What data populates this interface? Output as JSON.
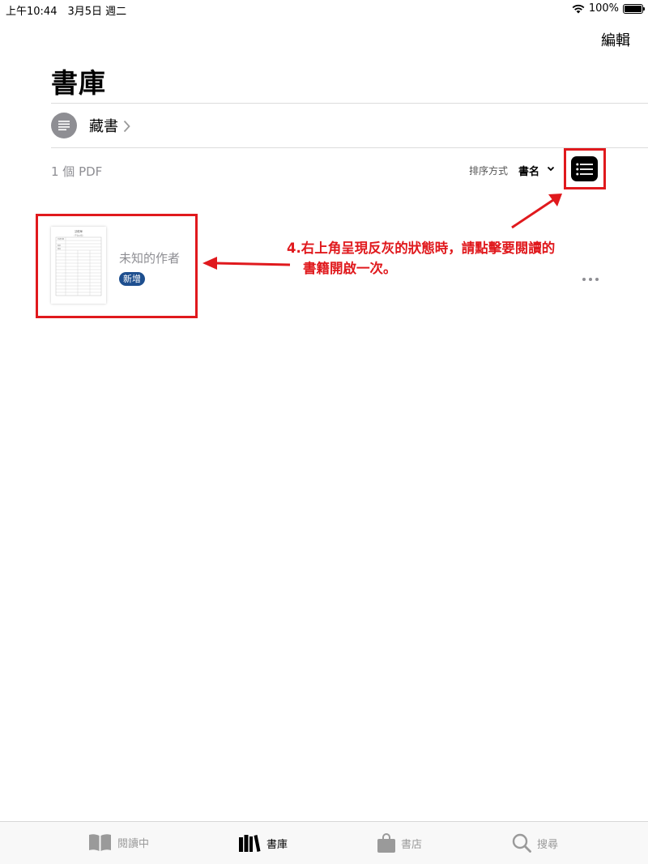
{
  "status_bar": {
    "time_date": "上午10:44　3月5日 週二",
    "battery": "100%",
    "battery_level": 1.0
  },
  "nav": {
    "edit_label": "編輯",
    "title": "書庫"
  },
  "collection": {
    "label": "藏書"
  },
  "toolbar": {
    "count": "1 個 PDF",
    "sort_label": "排序方式",
    "sort_value": "書名"
  },
  "book": {
    "author": "未知的作者",
    "badge": "新增",
    "thumb_lines": [
      "請假單",
      "（不含公假）",
      "申請日期",
      "假別",
      "事由"
    ]
  },
  "annotation": {
    "line1": "4.右上角呈現反灰的狀態時，請點擊要閱讀的",
    "line2": "書籍開啟一次。",
    "color": "#e0191d"
  },
  "tabs": [
    {
      "label": "閱讀中",
      "icon": "book-open-icon",
      "active": false
    },
    {
      "label": "書庫",
      "icon": "library-icon",
      "active": true
    },
    {
      "label": "書店",
      "icon": "shopping-bag-icon",
      "active": false
    },
    {
      "label": "搜尋",
      "icon": "search-icon",
      "active": false
    }
  ]
}
